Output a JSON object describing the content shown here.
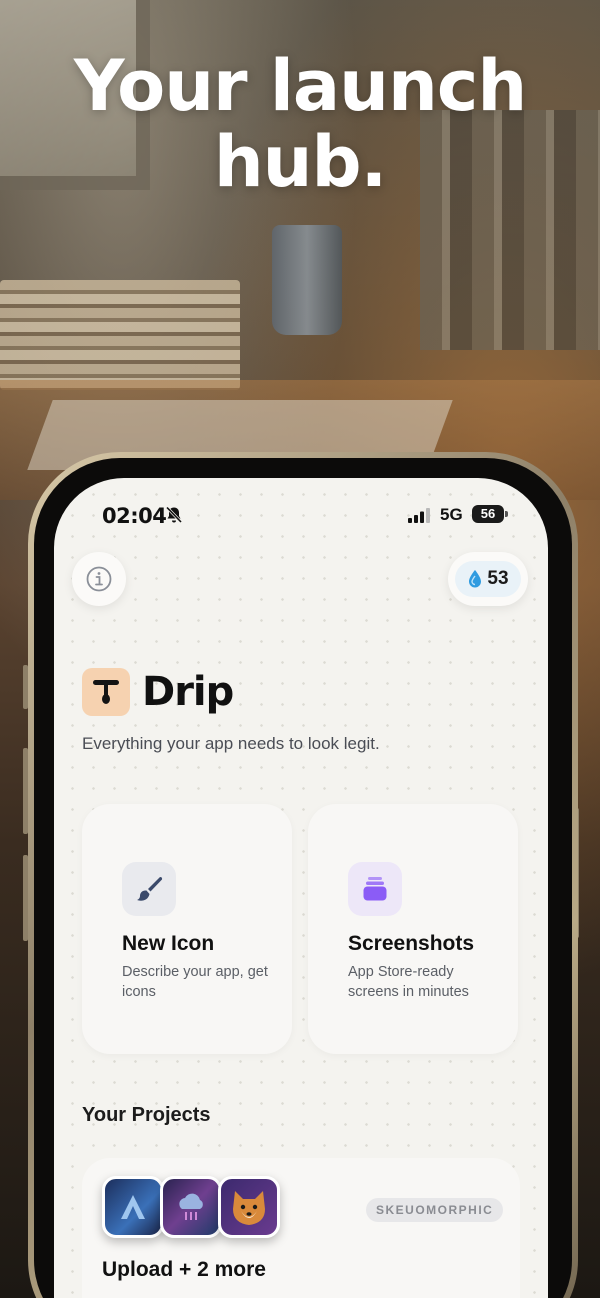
{
  "marketing": {
    "headline_line1": "Your launch",
    "headline_line2": "hub."
  },
  "status_bar": {
    "time": "02:04",
    "network": "5G",
    "battery": "56",
    "icons": [
      "bell-slash-icon",
      "signal-bars-icon",
      "battery-icon"
    ]
  },
  "header": {
    "info_icon": "info-icon",
    "credits_icon": "drop-icon",
    "credits_count": "53"
  },
  "app": {
    "name": "Drip",
    "tagline": "Everything your app needs to look legit."
  },
  "actions": [
    {
      "title": "New Icon",
      "description": "Describe your app, get icons",
      "icon": "paintbrush-icon"
    },
    {
      "title": "Screenshots",
      "description": "App Store-ready screens in minutes",
      "icon": "stack-icon"
    }
  ],
  "projects": {
    "section_title": "Your Projects",
    "items": [
      {
        "title": "Upload + 2 more",
        "style_badge": "SKEUOMORPHIC"
      }
    ]
  },
  "colors": {
    "accent_purple": "#8b5cf6",
    "brand_logo_bg": "#f6d2b0",
    "credits_bg": "#e9f2f8",
    "drop_blue": "#2f9be0"
  }
}
